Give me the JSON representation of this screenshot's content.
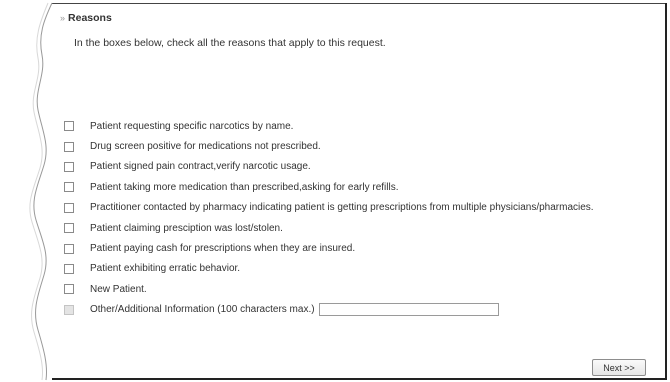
{
  "section": {
    "title": "Reasons",
    "intro": "In the boxes below, check all the reasons that apply to this request."
  },
  "reasons": [
    {
      "label": "Patient requesting specific narcotics by name."
    },
    {
      "label": "Drug screen positive for medications not prescribed."
    },
    {
      "label": "Patient signed pain contract,verify narcotic usage."
    },
    {
      "label": "Patient taking more medication than prescribed,asking for early refills."
    },
    {
      "label": "Practitioner contacted by pharmacy indicating patient is getting prescriptions from multiple physicians/pharmacies."
    },
    {
      "label": "Patient claiming presciption was lost/stolen."
    },
    {
      "label": "Patient paying cash for prescriptions when they are insured."
    },
    {
      "label": "Patient exhibiting erratic behavior."
    },
    {
      "label": "New Patient."
    }
  ],
  "other": {
    "label": "Other/Additional Information (100 characters max.)",
    "value": ""
  },
  "buttons": {
    "next_label": "Next >>"
  }
}
